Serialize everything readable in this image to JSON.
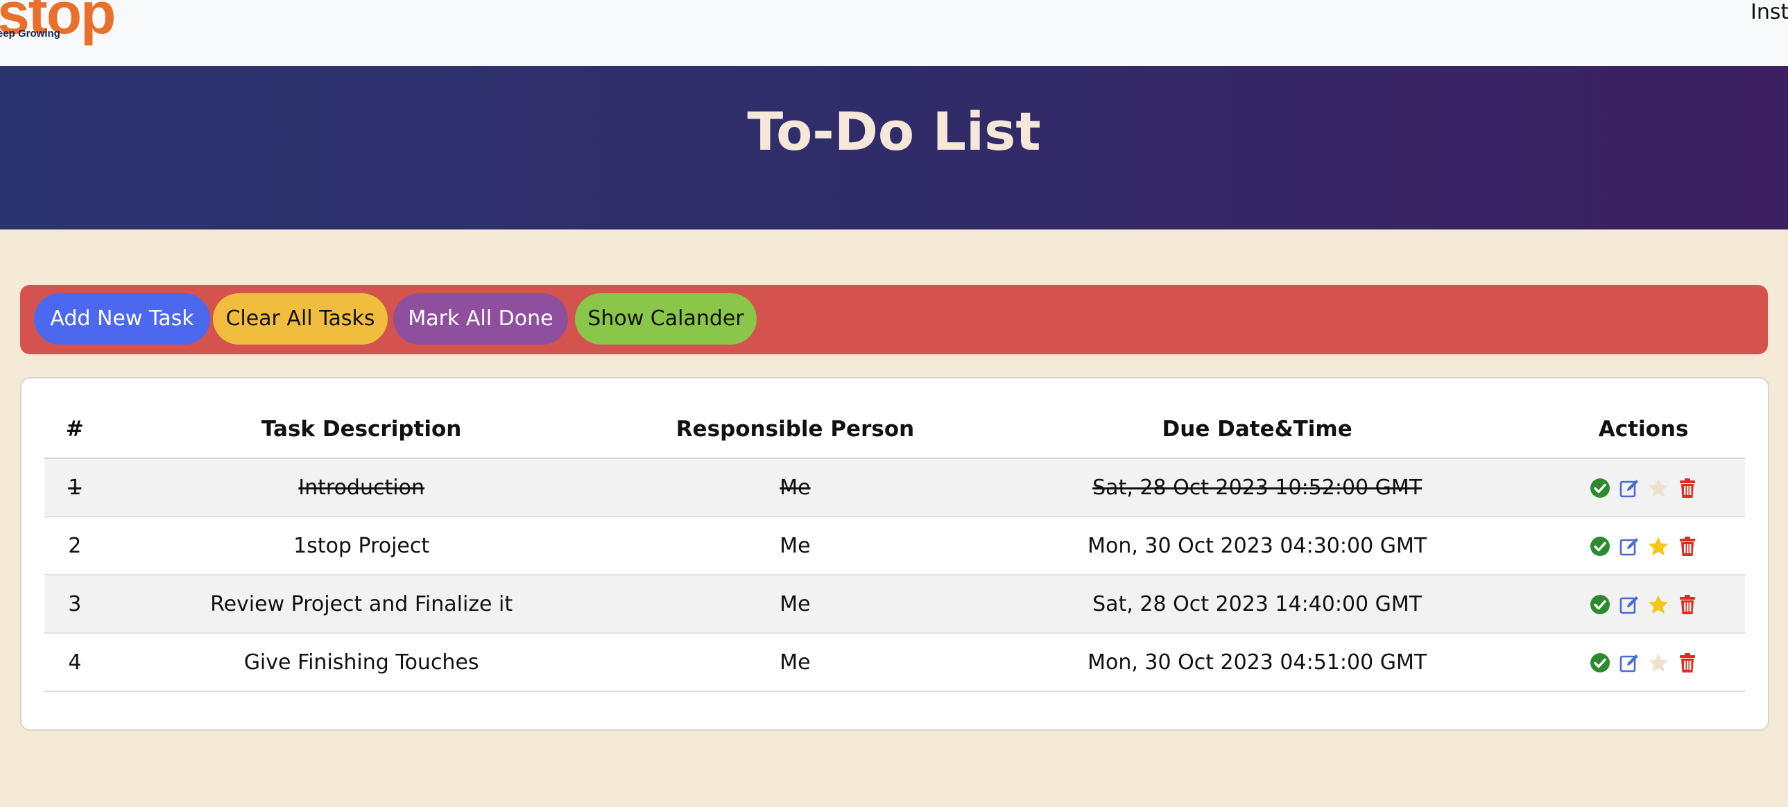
{
  "navbar": {
    "logo_word": "stop",
    "logo_tagline": "eep Growing",
    "right_text": "Inst"
  },
  "banner": {
    "title": "To-Do List"
  },
  "toolbar": {
    "add_label": "Add New Task",
    "clear_label": "Clear All Tasks",
    "mark_done_label": "Mark All Done",
    "calendar_label": "Show Calander"
  },
  "table": {
    "headers": [
      "#",
      "Task Description",
      "Responsible Person",
      "Due Date&Time",
      "Actions"
    ],
    "rows": [
      {
        "num": "1",
        "description": "Introduction",
        "person": "Me",
        "due": "Sat, 28 Oct 2023 10:52:00 GMT",
        "done": true,
        "starred": false
      },
      {
        "num": "2",
        "description": "1stop Project",
        "person": "Me",
        "due": "Mon, 30 Oct 2023 04:30:00 GMT",
        "done": false,
        "starred": true
      },
      {
        "num": "3",
        "description": "Review Project and Finalize it",
        "person": "Me",
        "due": "Sat, 28 Oct 2023 14:40:00 GMT",
        "done": false,
        "starred": true
      },
      {
        "num": "4",
        "description": "Give Finishing Touches",
        "person": "Me",
        "due": "Mon, 30 Oct 2023 04:51:00 GMT",
        "done": false,
        "starred": false
      }
    ]
  },
  "icons": {
    "complete": "check-circle-icon",
    "edit": "edit-icon",
    "star": "star-icon",
    "delete": "trash-icon"
  },
  "colors": {
    "page_bg": "#f5ead8",
    "banner_start": "#2b336e",
    "banner_end": "#3c2061",
    "toolbar_bg": "#d5534e",
    "add_button": "#4b68ee",
    "clear_button": "#f1bd3f",
    "mark_done_button": "#8e4f9f",
    "calendar_button": "#8ac649",
    "check": "#2f8a2f",
    "edit": "#4a6bd0",
    "star_on": "#f2c718",
    "star_off": "#ece3cf",
    "trash": "#e02b20"
  }
}
